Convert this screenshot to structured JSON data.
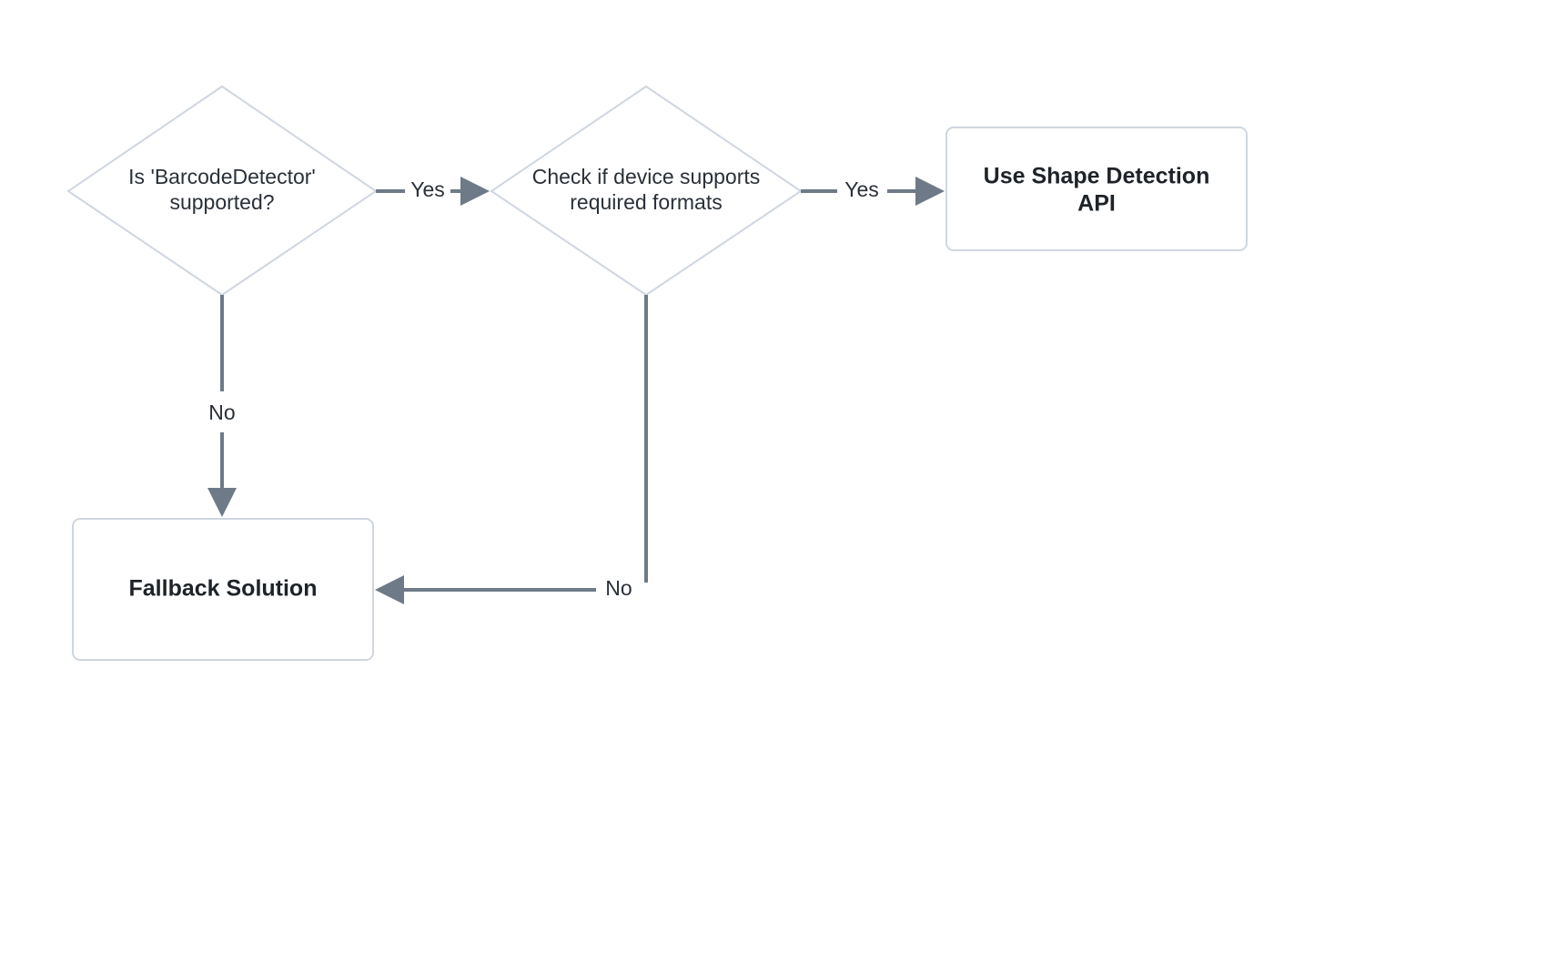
{
  "nodes": {
    "decision_barcode": {
      "line1": "Is 'BarcodeDetector'",
      "line2": "supported?"
    },
    "decision_formats": {
      "line1": "Check if device supports",
      "line2": "required formats"
    },
    "result_api": {
      "line1": "Use Shape Detection",
      "line2": "API"
    },
    "result_fallback": {
      "line1": "Fallback Solution"
    }
  },
  "edges": {
    "barcode_yes": "Yes",
    "barcode_no": "No",
    "formats_yes": "Yes",
    "formats_no": "No"
  },
  "chart_data": {
    "type": "flowchart",
    "nodes": [
      {
        "id": "decision_barcode",
        "type": "decision",
        "label": "Is 'BarcodeDetector' supported?"
      },
      {
        "id": "decision_formats",
        "type": "decision",
        "label": "Check if device supports required formats"
      },
      {
        "id": "result_api",
        "type": "process",
        "label": "Use Shape Detection API"
      },
      {
        "id": "result_fallback",
        "type": "process",
        "label": "Fallback Solution"
      }
    ],
    "edges": [
      {
        "from": "decision_barcode",
        "to": "decision_formats",
        "label": "Yes"
      },
      {
        "from": "decision_barcode",
        "to": "result_fallback",
        "label": "No"
      },
      {
        "from": "decision_formats",
        "to": "result_api",
        "label": "Yes"
      },
      {
        "from": "decision_formats",
        "to": "result_fallback",
        "label": "No"
      }
    ]
  }
}
